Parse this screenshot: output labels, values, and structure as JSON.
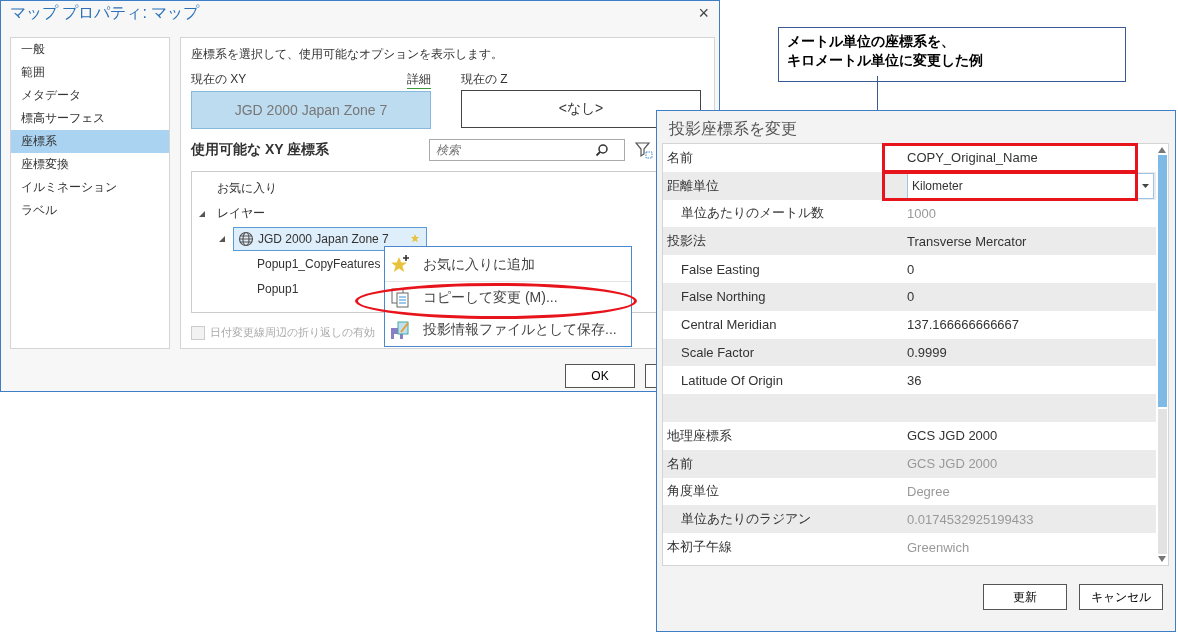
{
  "map_dialog": {
    "title": "マップ プロパティ: マップ",
    "close": "×",
    "sidebar": [
      {
        "label": "一般",
        "selected": false
      },
      {
        "label": "範囲",
        "selected": false
      },
      {
        "label": "メタデータ",
        "selected": false
      },
      {
        "label": "標高サーフェス",
        "selected": false
      },
      {
        "label": "座標系",
        "selected": true
      },
      {
        "label": "座標変換",
        "selected": false
      },
      {
        "label": "イルミネーション",
        "selected": false
      },
      {
        "label": "ラベル",
        "selected": false
      }
    ],
    "description": "座標系を選択して、使用可能なオプションを表示します。",
    "current_xy": {
      "label": "現在の XY",
      "link": "詳細",
      "value": "JGD 2000 Japan Zone 7"
    },
    "current_z": {
      "label": "現在の Z",
      "value": "<なし>"
    },
    "available_title": "使用可能な XY 座標系",
    "search": {
      "placeholder": "検索"
    },
    "tree": [
      {
        "label": "お気に入り"
      },
      {
        "label": "レイヤー",
        "expanded": true,
        "children": [
          {
            "label": "JGD 2000 Japan Zone 7",
            "expanded": true,
            "selected": true,
            "children": [
              {
                "label": "Popup1_CopyFeatures"
              },
              {
                "label": "Popup1"
              }
            ]
          }
        ]
      }
    ],
    "checkbox": {
      "label": "日付変更線周辺の折り返しの有効",
      "checked": false
    },
    "buttons": [
      "OK"
    ]
  },
  "context_menu": {
    "items": [
      {
        "label": "お気に入りに追加",
        "highlighted": false
      },
      {
        "label": "コピーして変更 (M)...",
        "highlighted": true
      },
      {
        "label": "投影情報ファイルとして保存...",
        "highlighted": false
      }
    ]
  },
  "callout": {
    "lines": [
      "メートル単位の座標系を、",
      "キロメートル単位に変更した例"
    ]
  },
  "projection_dialog": {
    "title": "投影座標系を変更",
    "rows": [
      {
        "label": "名前",
        "value": "COPY_Original_Name",
        "kind": "text",
        "disabled": false,
        "highlighted": true
      },
      {
        "label": "距離単位",
        "value": "Kilometer",
        "kind": "dropdown",
        "disabled": false,
        "highlighted": true,
        "children": [
          {
            "label": "単位あたりのメートル数",
            "value": "1000",
            "kind": "text",
            "disabled": true
          }
        ]
      },
      {
        "label": "投影法",
        "value": "Transverse Mercator",
        "kind": "text",
        "disabled": false,
        "children": [
          {
            "label": "False Easting",
            "value": "0",
            "kind": "text",
            "disabled": false
          },
          {
            "label": "False Northing",
            "value": "0",
            "kind": "text",
            "disabled": false
          },
          {
            "label": "Central Meridian",
            "value": "137.166666666667",
            "kind": "text",
            "disabled": false
          },
          {
            "label": "Scale Factor",
            "value": "0.9999",
            "kind": "text",
            "disabled": false
          },
          {
            "label": "Latitude Of Origin",
            "value": "36",
            "kind": "text",
            "disabled": false
          }
        ]
      },
      {
        "kind": "blank"
      },
      {
        "label": "地理座標系",
        "value": "GCS JGD 2000",
        "kind": "text",
        "disabled": false
      },
      {
        "label": "名前",
        "value": "GCS JGD 2000",
        "kind": "text",
        "disabled": true
      },
      {
        "label": "角度単位",
        "value": "Degree",
        "kind": "text",
        "disabled": true,
        "children": [
          {
            "label": "単位あたりのラジアン",
            "value": "0.0174532925199433",
            "kind": "text",
            "disabled": true
          }
        ]
      },
      {
        "label": "本初子午線",
        "value": "Greenwich",
        "kind": "text",
        "disabled": true
      }
    ],
    "buttons": [
      "更新",
      "キャンセル"
    ]
  }
}
